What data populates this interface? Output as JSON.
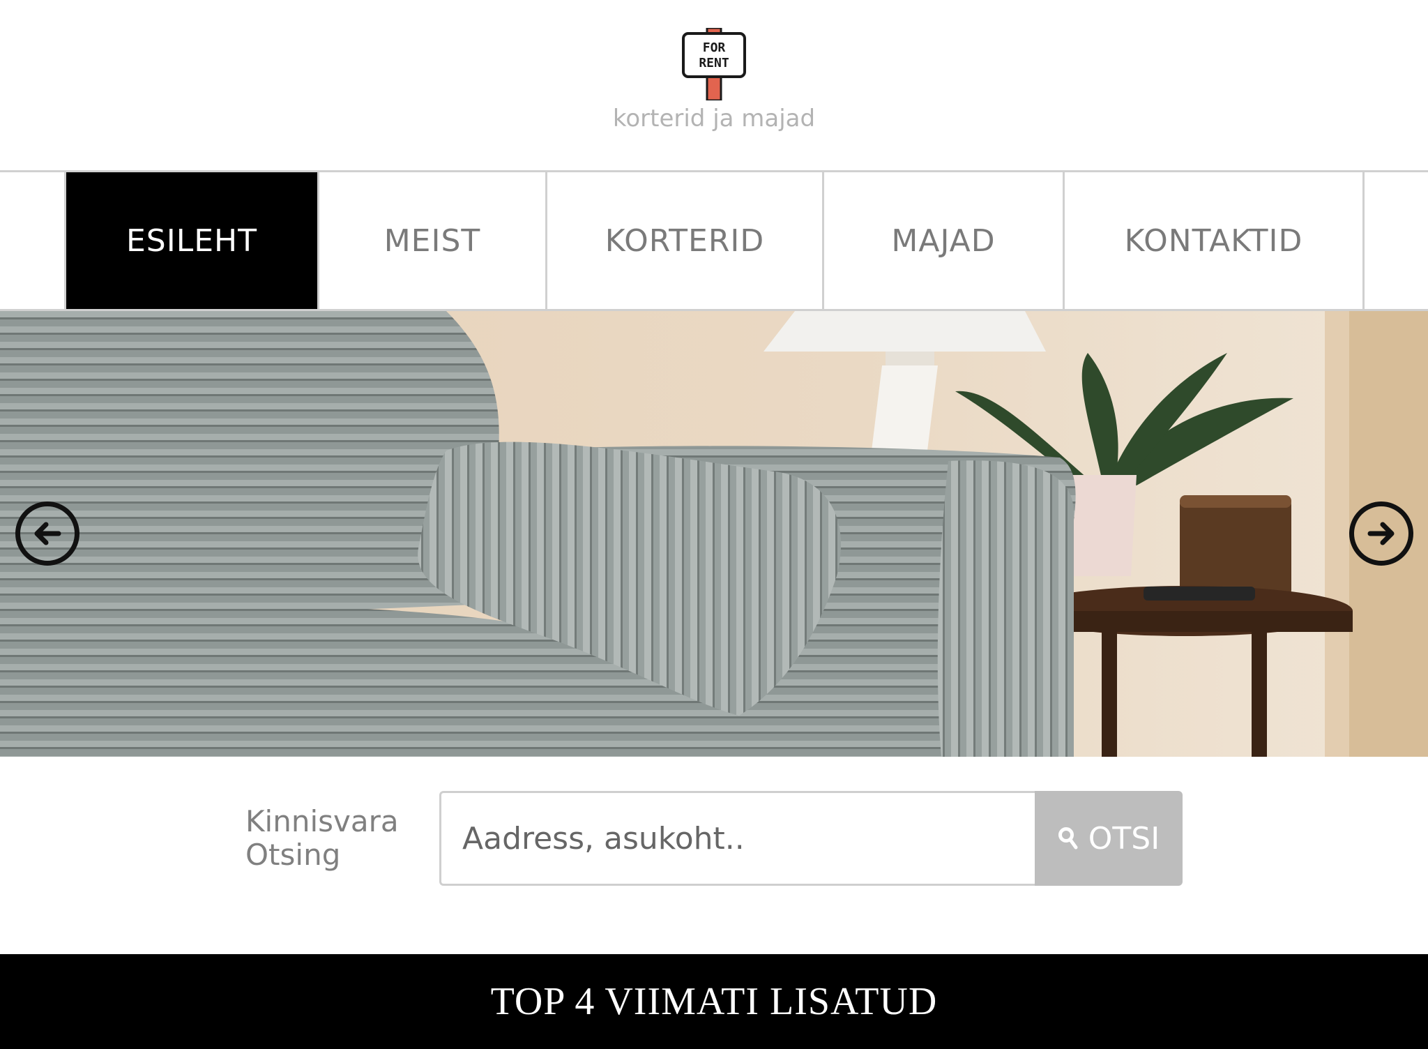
{
  "brand": {
    "sign_line1": "FOR",
    "sign_line2": "RENT",
    "tagline": "korterid ja majad"
  },
  "nav": {
    "items": [
      {
        "label": "ESILEHT",
        "active": true
      },
      {
        "label": "MEIST",
        "active": false
      },
      {
        "label": "KORTERID",
        "active": false
      },
      {
        "label": "MAJAD",
        "active": false
      },
      {
        "label": "KONTAKTID",
        "active": false
      }
    ]
  },
  "hero": {
    "prev_icon": "arrow-left-circle-icon",
    "next_icon": "arrow-right-circle-icon"
  },
  "search": {
    "label_line1": "Kinnisvara",
    "label_line2": "Otsing",
    "placeholder": "Aadress, asukoht..",
    "button_label": "OTSI",
    "button_icon": "search-icon"
  },
  "section": {
    "title": "TOP 4 VIIMATI LISATUD"
  },
  "colors": {
    "active_nav_bg": "#000000",
    "nav_text": "#7a7a7a",
    "button_bg": "#bdbdbd",
    "band_bg": "#000000"
  }
}
